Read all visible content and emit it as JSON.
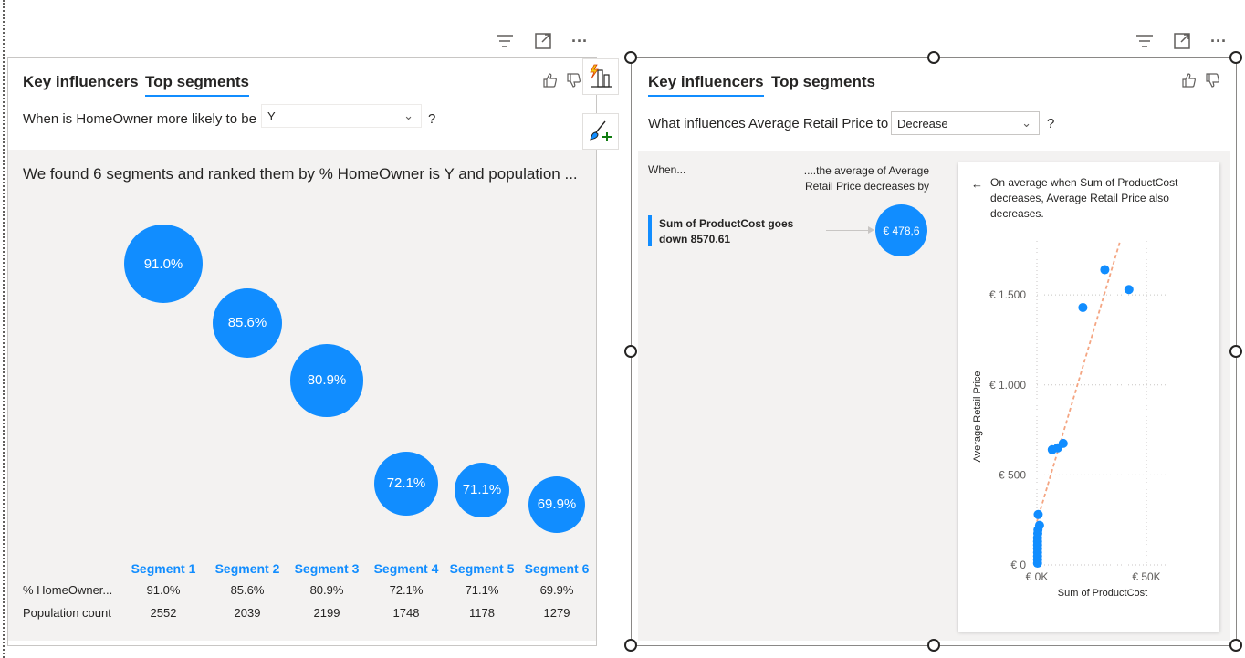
{
  "left_visual": {
    "tabs": [
      {
        "label": "Key influencers",
        "active": false
      },
      {
        "label": "Top segments",
        "active": true
      }
    ],
    "question_prefix": "When is HomeOwner more likely to be",
    "selected_value": "Y",
    "question_suffix": "?",
    "summary": "We found 6 segments and ranked them by % HomeOwner is Y and population ...",
    "segments": [
      {
        "name": "Segment 1",
        "percent_label": "91.0%",
        "percent": 91.0,
        "homeowner": "91.0%",
        "population": "2552"
      },
      {
        "name": "Segment 2",
        "percent_label": "85.6%",
        "percent": 85.6,
        "homeowner": "85.6%",
        "population": "2039"
      },
      {
        "name": "Segment 3",
        "percent_label": "80.9%",
        "percent": 80.9,
        "homeowner": "80.9%",
        "population": "2199"
      },
      {
        "name": "Segment 4",
        "percent_label": "72.1%",
        "percent": 72.1,
        "homeowner": "72.1%",
        "population": "1748"
      },
      {
        "name": "Segment 5",
        "percent_label": "71.1%",
        "percent": 71.1,
        "homeowner": "71.1%",
        "population": "1178"
      },
      {
        "name": "Segment 6",
        "percent_label": "69.9%",
        "percent": 69.9,
        "homeowner": "69.9%",
        "population": "1279"
      }
    ],
    "row_headers": {
      "homeowner": "% HomeOwner...",
      "population": "Population count"
    }
  },
  "right_visual": {
    "tabs": [
      {
        "label": "Key influencers",
        "active": true
      },
      {
        "label": "Top segments",
        "active": false
      }
    ],
    "question_prefix": "What influences Average Retail Price to",
    "selected_value": "Decrease",
    "question_suffix": "?",
    "when_header": "When...",
    "result_header": "....the average of Average Retail Price decreases by",
    "influencer_text": "Sum of ProductCost goes down 8570.61",
    "influencer_value": "€ 478,6",
    "detail_back_icon": "←",
    "detail_text": "On average when Sum of ProductCost decreases, Average Retail Price also decreases."
  },
  "icons": {
    "filter": "filter-icon",
    "focus": "focus-mode-icon",
    "more": "more-options-icon",
    "thumbs_up": "thumbs-up-icon",
    "thumbs_down": "thumbs-down-icon"
  },
  "colors": {
    "accent": "#118dff",
    "trend": "#f4a582",
    "panel_bg": "#f3f2f1"
  },
  "chart_data": {
    "type": "scatter",
    "xlabel": "Sum of ProductCost",
    "ylabel": "Average Retail Price",
    "x_ticks": [
      "€ 0K",
      "€ 50K"
    ],
    "y_ticks": [
      "€ 0",
      "€ 500",
      "€ 1.000",
      "€ 1.500"
    ],
    "xlim": [
      0,
      60000
    ],
    "ylim": [
      0,
      1800
    ],
    "grid": true,
    "points": [
      {
        "x": 300,
        "y": 10
      },
      {
        "x": 300,
        "y": 30
      },
      {
        "x": 300,
        "y": 50
      },
      {
        "x": 300,
        "y": 70
      },
      {
        "x": 300,
        "y": 90
      },
      {
        "x": 300,
        "y": 110
      },
      {
        "x": 300,
        "y": 130
      },
      {
        "x": 300,
        "y": 150
      },
      {
        "x": 400,
        "y": 175
      },
      {
        "x": 500,
        "y": 195
      },
      {
        "x": 1200,
        "y": 220
      },
      {
        "x": 600,
        "y": 280
      },
      {
        "x": 7000,
        "y": 640
      },
      {
        "x": 9500,
        "y": 650
      },
      {
        "x": 12000,
        "y": 675
      },
      {
        "x": 21000,
        "y": 1430
      },
      {
        "x": 31000,
        "y": 1640
      },
      {
        "x": 42000,
        "y": 1530
      }
    ],
    "trendline": [
      {
        "x": 0,
        "y": 240
      },
      {
        "x": 38000,
        "y": 1800
      }
    ]
  }
}
